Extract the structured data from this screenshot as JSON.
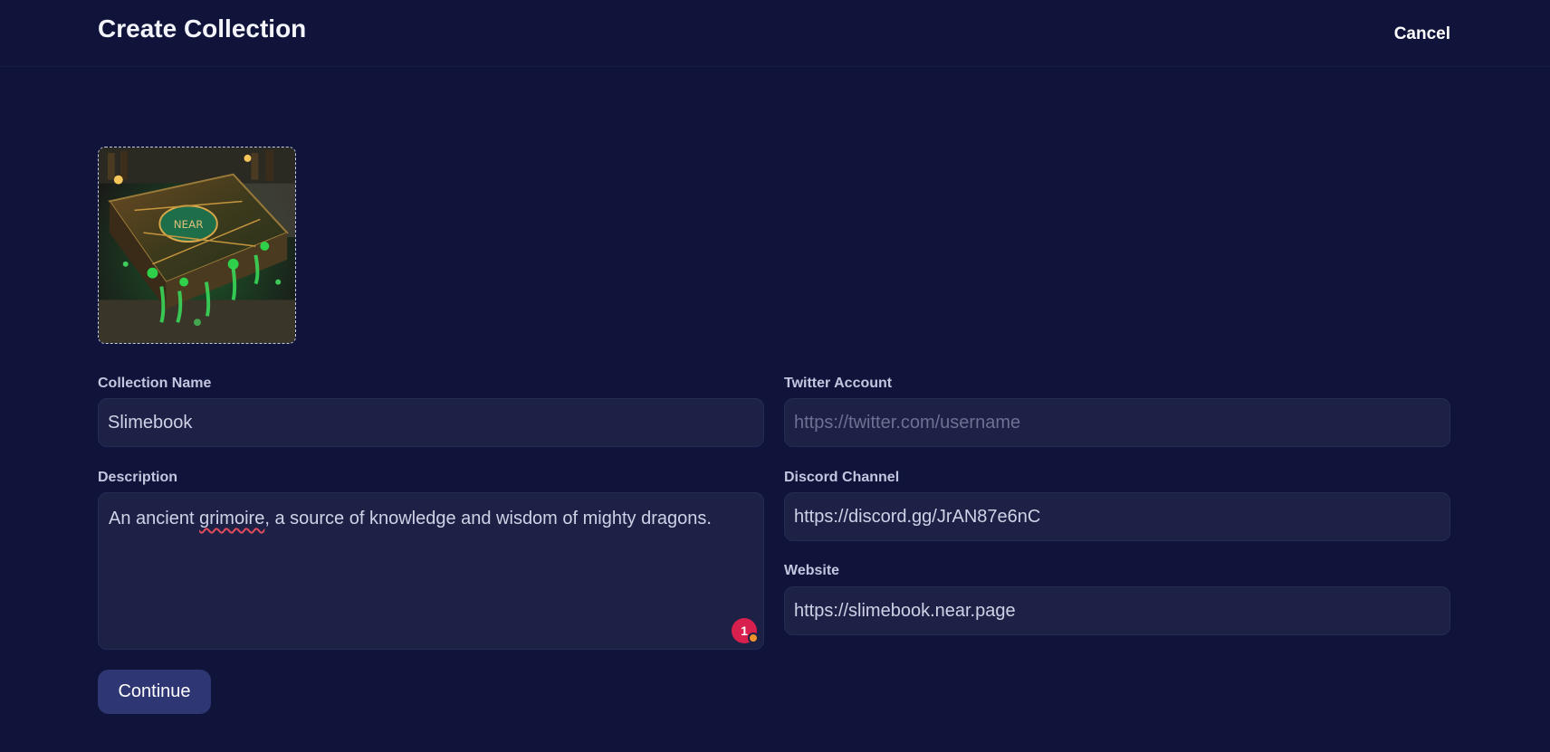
{
  "header": {
    "title": "Create Collection",
    "cancel_label": "Cancel"
  },
  "image": {
    "icon": "collection-cover-image",
    "title_on_image": "NEAR"
  },
  "form": {
    "collection_name": {
      "label": "Collection Name",
      "value": "Slimebook"
    },
    "description": {
      "label": "Description",
      "value_before": "An ancient ",
      "value_misspelled": "grimoire",
      "value_after": ", a source of knowledge and wisdom of mighty dragons."
    },
    "twitter": {
      "label": "Twitter Account",
      "placeholder": "https://twitter.com/username",
      "value": ""
    },
    "discord": {
      "label": "Discord Channel",
      "value": "https://discord.gg/JrAN87e6nC"
    },
    "website": {
      "label": "Website",
      "value": "https://slimebook.near.page"
    }
  },
  "grammar_badge": {
    "count": "1",
    "color": "#d7204e",
    "dot_color": "#f0922b"
  },
  "actions": {
    "continue_label": "Continue"
  },
  "colors": {
    "background": "#10143a",
    "field": "#1d2145",
    "button": "#2e3673"
  }
}
